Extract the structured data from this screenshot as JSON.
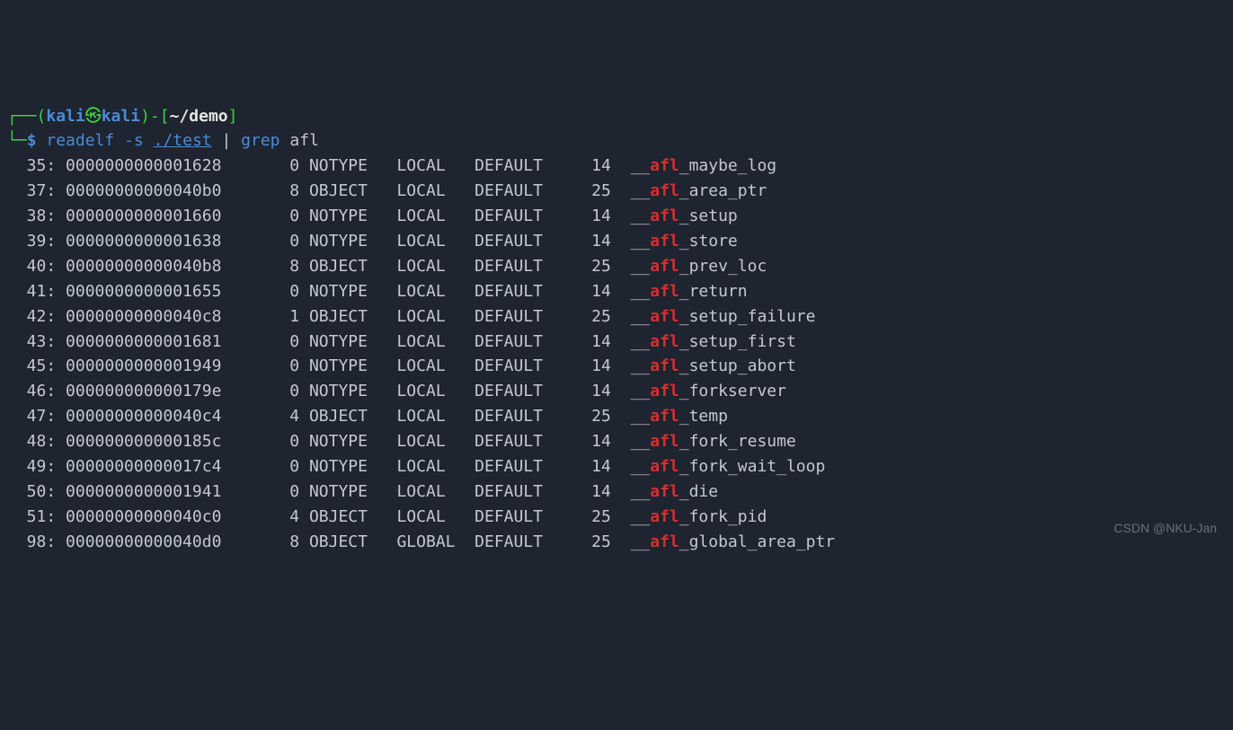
{
  "prompt": {
    "lparen": "(",
    "user": "kali",
    "skull": "㉿",
    "host": "kali",
    "rparen_dash": ")-[",
    "tilde": "~",
    "pathsep": "/",
    "dir": "demo",
    "rbracket": "]",
    "corner_top": "┌──",
    "corner_bot": "└─",
    "dollar": "$",
    "cmd_readelf": "readelf",
    "cmd_opt": "-s",
    "cmd_file": "./test",
    "pipe": "|",
    "cmd_grep": "grep",
    "cmd_arg": "afl"
  },
  "rows": [
    {
      "num": "35:",
      "addr": "0000000000001628",
      "size": "0",
      "type": "NOTYPE",
      "bind": "LOCAL",
      "vis": "DEFAULT",
      "ndx": "14",
      "pre": "__",
      "hi": "afl",
      "post": "_maybe_log"
    },
    {
      "num": "37:",
      "addr": "00000000000040b0",
      "size": "8",
      "type": "OBJECT",
      "bind": "LOCAL",
      "vis": "DEFAULT",
      "ndx": "25",
      "pre": "__",
      "hi": "afl",
      "post": "_area_ptr"
    },
    {
      "num": "38:",
      "addr": "0000000000001660",
      "size": "0",
      "type": "NOTYPE",
      "bind": "LOCAL",
      "vis": "DEFAULT",
      "ndx": "14",
      "pre": "__",
      "hi": "afl",
      "post": "_setup"
    },
    {
      "num": "39:",
      "addr": "0000000000001638",
      "size": "0",
      "type": "NOTYPE",
      "bind": "LOCAL",
      "vis": "DEFAULT",
      "ndx": "14",
      "pre": "__",
      "hi": "afl",
      "post": "_store"
    },
    {
      "num": "40:",
      "addr": "00000000000040b8",
      "size": "8",
      "type": "OBJECT",
      "bind": "LOCAL",
      "vis": "DEFAULT",
      "ndx": "25",
      "pre": "__",
      "hi": "afl",
      "post": "_prev_loc"
    },
    {
      "num": "41:",
      "addr": "0000000000001655",
      "size": "0",
      "type": "NOTYPE",
      "bind": "LOCAL",
      "vis": "DEFAULT",
      "ndx": "14",
      "pre": "__",
      "hi": "afl",
      "post": "_return"
    },
    {
      "num": "42:",
      "addr": "00000000000040c8",
      "size": "1",
      "type": "OBJECT",
      "bind": "LOCAL",
      "vis": "DEFAULT",
      "ndx": "25",
      "pre": "__",
      "hi": "afl",
      "post": "_setup_failure"
    },
    {
      "num": "43:",
      "addr": "0000000000001681",
      "size": "0",
      "type": "NOTYPE",
      "bind": "LOCAL",
      "vis": "DEFAULT",
      "ndx": "14",
      "pre": "__",
      "hi": "afl",
      "post": "_setup_first"
    },
    {
      "num": "45:",
      "addr": "0000000000001949",
      "size": "0",
      "type": "NOTYPE",
      "bind": "LOCAL",
      "vis": "DEFAULT",
      "ndx": "14",
      "pre": "__",
      "hi": "afl",
      "post": "_setup_abort"
    },
    {
      "num": "46:",
      "addr": "000000000000179e",
      "size": "0",
      "type": "NOTYPE",
      "bind": "LOCAL",
      "vis": "DEFAULT",
      "ndx": "14",
      "pre": "__",
      "hi": "afl",
      "post": "_forkserver"
    },
    {
      "num": "47:",
      "addr": "00000000000040c4",
      "size": "4",
      "type": "OBJECT",
      "bind": "LOCAL",
      "vis": "DEFAULT",
      "ndx": "25",
      "pre": "__",
      "hi": "afl",
      "post": "_temp"
    },
    {
      "num": "48:",
      "addr": "000000000000185c",
      "size": "0",
      "type": "NOTYPE",
      "bind": "LOCAL",
      "vis": "DEFAULT",
      "ndx": "14",
      "pre": "__",
      "hi": "afl",
      "post": "_fork_resume"
    },
    {
      "num": "49:",
      "addr": "00000000000017c4",
      "size": "0",
      "type": "NOTYPE",
      "bind": "LOCAL",
      "vis": "DEFAULT",
      "ndx": "14",
      "pre": "__",
      "hi": "afl",
      "post": "_fork_wait_loop"
    },
    {
      "num": "50:",
      "addr": "0000000000001941",
      "size": "0",
      "type": "NOTYPE",
      "bind": "LOCAL",
      "vis": "DEFAULT",
      "ndx": "14",
      "pre": "__",
      "hi": "afl",
      "post": "_die"
    },
    {
      "num": "51:",
      "addr": "00000000000040c0",
      "size": "4",
      "type": "OBJECT",
      "bind": "LOCAL",
      "vis": "DEFAULT",
      "ndx": "25",
      "pre": "__",
      "hi": "afl",
      "post": "_fork_pid"
    },
    {
      "num": "98:",
      "addr": "00000000000040d0",
      "size": "8",
      "type": "OBJECT",
      "bind": "GLOBAL",
      "vis": "DEFAULT",
      "ndx": "25",
      "pre": "__",
      "hi": "afl",
      "post": "_global_area_ptr"
    }
  ],
  "watermark": "CSDN @NKU-Jan"
}
